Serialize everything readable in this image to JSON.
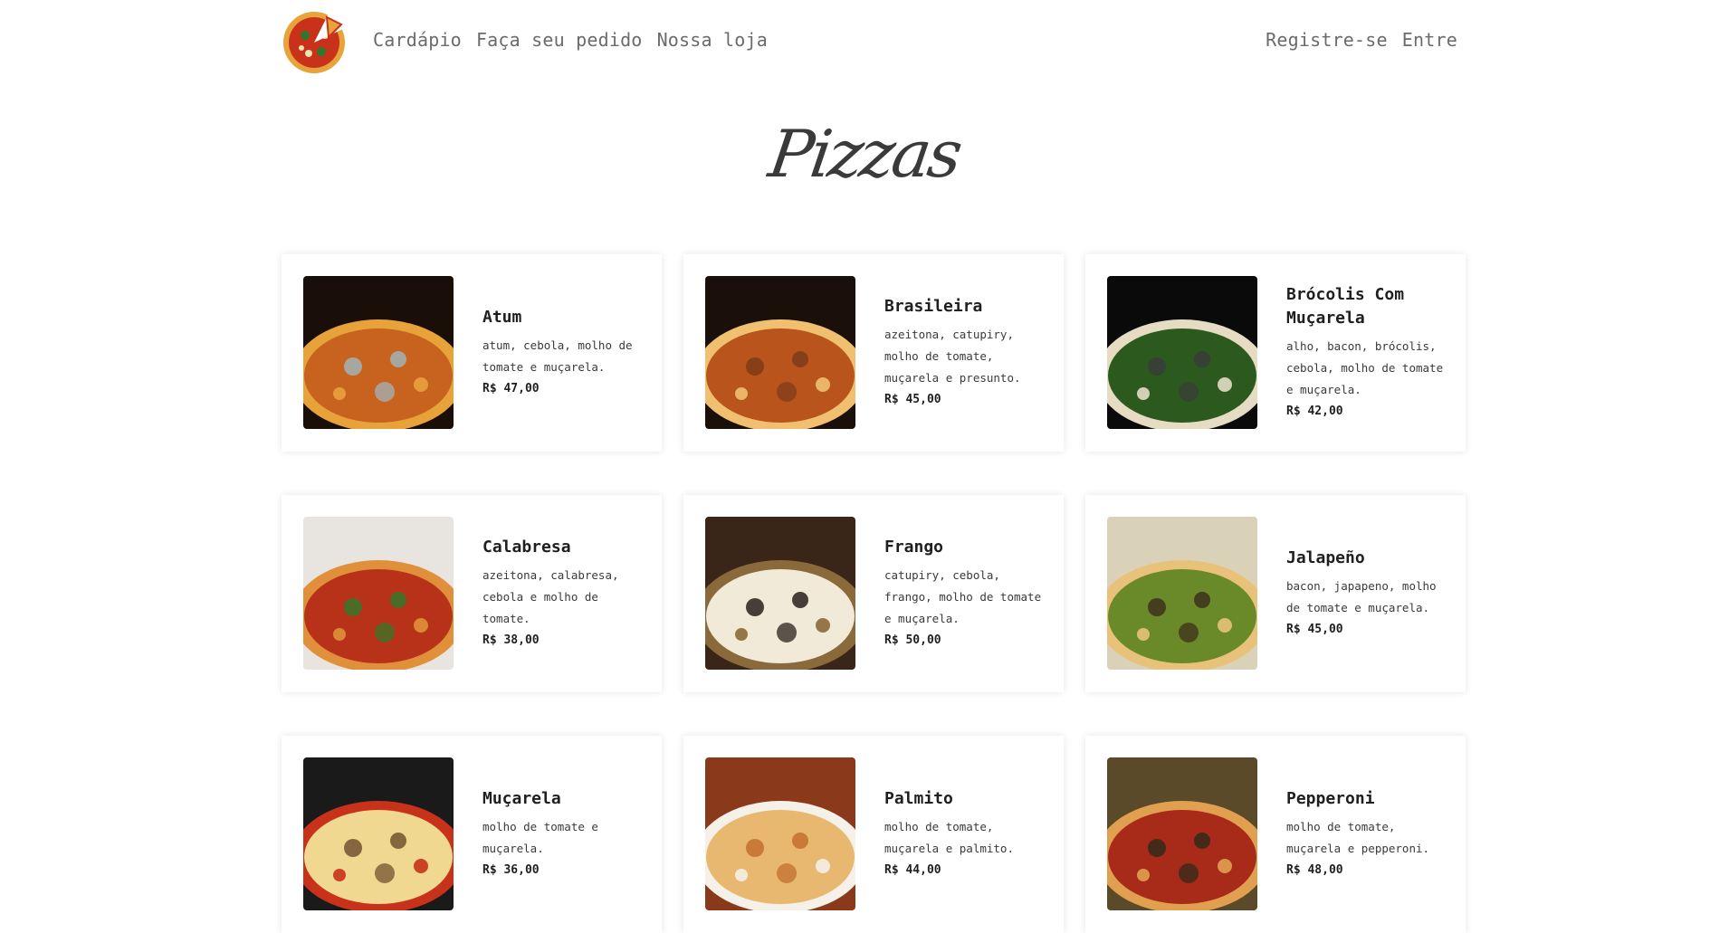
{
  "nav": {
    "logo_alt": "pizza-logo",
    "left": [
      "Cardápio",
      "Faça seu pedido",
      "Nossa loja"
    ],
    "right": [
      "Registre-se",
      "Entre"
    ]
  },
  "page": {
    "title": "Pizzas"
  },
  "pizzas": [
    {
      "name": "Atum",
      "desc": "atum, cebola, molho de tomate e muçarela.",
      "price": "R$ 47,00",
      "photo": [
        "#1a0e08",
        "#c8621f",
        "#e8a23a",
        "#9fb8c0"
      ]
    },
    {
      "name": "Brasileira",
      "desc": "azeitona, catupiry, molho de tomate, muçarela e presunto.",
      "price": "R$ 45,00",
      "photo": [
        "#1b0f0a",
        "#b8541c",
        "#f0c070",
        "#7a3a18"
      ]
    },
    {
      "name": "Brócolis Com Muçarela",
      "desc": "alho, bacon, brócolis, cebola, molho de tomate e muçarela.",
      "price": "R$ 42,00",
      "photo": [
        "#0a0a0a",
        "#2c5a1e",
        "#e6dcc4",
        "#3a3a3a"
      ]
    },
    {
      "name": "Calabresa",
      "desc": "azeitona, calabresa, cebola e molho de tomate.",
      "price": "R$ 38,00",
      "photo": [
        "#e8e4e0",
        "#b8321a",
        "#e0903a",
        "#2e7a2a"
      ]
    },
    {
      "name": "Frango",
      "desc": "catupiry, cebola, frango, molho de tomate e muçarela.",
      "price": "R$ 50,00",
      "photo": [
        "#3a2618",
        "#f2ead8",
        "#8a6a3a",
        "#1a1410"
      ]
    },
    {
      "name": "Jalapeño",
      "desc": "bacon, japapeno, molho de tomate e muçarela.",
      "price": "R$ 45,00",
      "photo": [
        "#d9d2b8",
        "#6a8a2a",
        "#e8c27a",
        "#3a2a1a"
      ]
    },
    {
      "name": "Muçarela",
      "desc": "molho de tomate e muçarela.",
      "price": "R$ 36,00",
      "photo": [
        "#1a1a1a",
        "#f0d890",
        "#c8321a",
        "#6a4a2a"
      ]
    },
    {
      "name": "Palmito",
      "desc": "molho de tomate, muçarela e palmito.",
      "price": "R$ 44,00",
      "photo": [
        "#8a3a1a",
        "#e8b870",
        "#f5f0e8",
        "#c06a2a"
      ]
    },
    {
      "name": "Pepperoni",
      "desc": "molho de tomate, muçarela e pepperoni.",
      "price": "R$ 48,00",
      "photo": [
        "#5a4a2a",
        "#a82a18",
        "#e0a050",
        "#2a2a1a"
      ]
    }
  ]
}
